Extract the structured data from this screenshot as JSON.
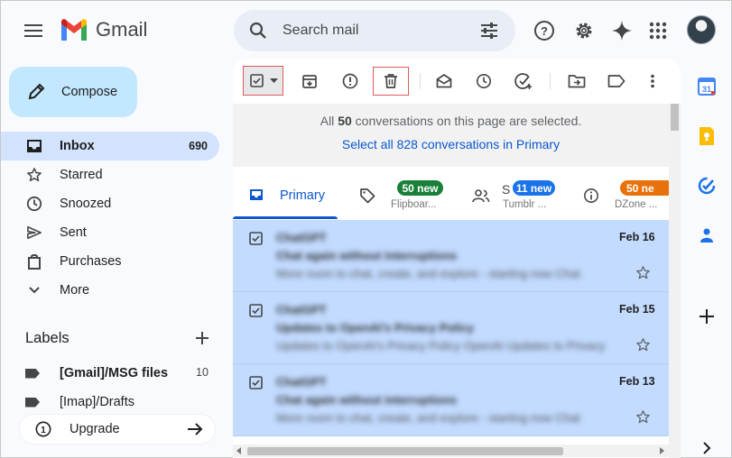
{
  "app": {
    "logo_text": "Gmail",
    "search_placeholder": "Search mail"
  },
  "sidebar": {
    "compose_label": "Compose",
    "items": [
      {
        "label": "Inbox",
        "count": "690",
        "icon": "inbox-icon",
        "active": true
      },
      {
        "label": "Starred",
        "icon": "star-icon"
      },
      {
        "label": "Snoozed",
        "icon": "clock-icon"
      },
      {
        "label": "Sent",
        "icon": "send-icon"
      },
      {
        "label": "Purchases",
        "icon": "bag-icon"
      },
      {
        "label": "More",
        "icon": "chevron-down-icon"
      }
    ],
    "labels_heading": "Labels",
    "labels": [
      {
        "label": "[Gmail]/MSG files",
        "count": "10"
      },
      {
        "label": "[Imap]/Drafts"
      }
    ],
    "upgrade_label": "Upgrade"
  },
  "banner": {
    "line1_pre": "All ",
    "line1_num": "50",
    "line1_post": " conversations on this page are selected.",
    "line2": "Select all 828 conversations in Primary"
  },
  "tabs": {
    "primary": "Primary",
    "promotions": {
      "badge": "50 new",
      "sub": "Flipboar..."
    },
    "social": {
      "badge": "11 new",
      "sub": "Tumblr ...",
      "letter": "S"
    },
    "updates": {
      "badge": "50 ne",
      "sub": "DZone ..."
    }
  },
  "colors": {
    "accent": "#0b57d0",
    "compose_bg": "#c2e7ff",
    "selected_row": "#c2dbff",
    "badge_green": "#188038",
    "badge_blue": "#1a73e8",
    "badge_orange": "#e8710a"
  },
  "emails": [
    {
      "sender": "ChatGPT",
      "subject": "Chat again without interruptions",
      "snippet": "More room to chat, create, and explore - starting now Chat",
      "date": "Feb 16"
    },
    {
      "sender": "ChatGPT",
      "subject": "Updates to OpenAI's Privacy Policy",
      "snippet": "Updates to OpenAI's Privacy Policy OpenAI Updates to Privacy",
      "date": "Feb 15"
    },
    {
      "sender": "ChatGPT",
      "subject": "Chat again without interruptions",
      "snippet": "More room to chat, create, and explore - starting now Chat",
      "date": "Feb 13"
    }
  ]
}
